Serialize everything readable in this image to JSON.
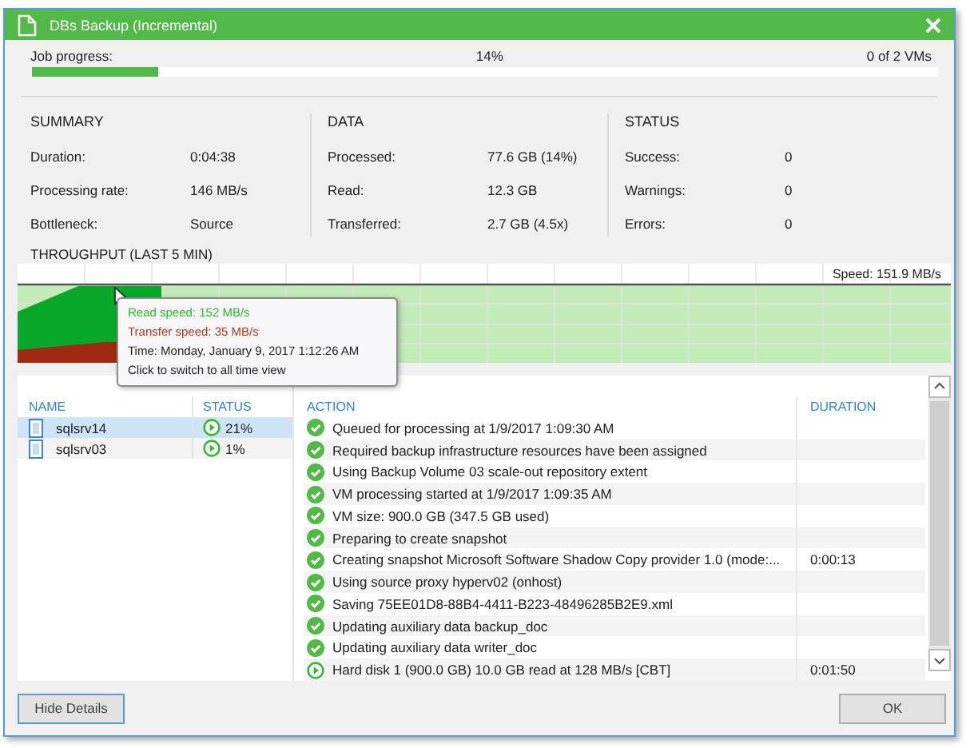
{
  "window": {
    "title": "DBs Backup (Incremental)"
  },
  "job_progress": {
    "label": "Job progress:",
    "percent": "14%",
    "count": "0 of 2 VMs",
    "level": 0.14
  },
  "sections": [
    {
      "title": "SUMMARY",
      "rows": [
        {
          "label": "Duration:",
          "value": "0:04:38"
        },
        {
          "label": "Processing rate:",
          "value": "146 MB/s"
        },
        {
          "label": "Bottleneck:",
          "value": "Source"
        }
      ]
    },
    {
      "title": "DATA",
      "rows": [
        {
          "label": "Processed:",
          "value": "77.6 GB (14%)"
        },
        {
          "label": "Read:",
          "value": "12.3 GB"
        },
        {
          "label": "Transferred:",
          "value": "2.7 GB (4.5x)"
        }
      ]
    },
    {
      "title": "STATUS",
      "rows": [
        {
          "label": "Success:",
          "value": "0"
        },
        {
          "label": "Warnings:",
          "value": "0"
        },
        {
          "label": "Errors:",
          "value": "0"
        }
      ]
    }
  ],
  "throughput": {
    "title": "THROUGHPUT (LAST 5 MIN)",
    "speed": "Speed: 151.9 MB/s",
    "tooltip": [
      {
        "kind": "read",
        "text": "Read speed: 152 MB/s"
      },
      {
        "kind": "transfer",
        "text": "Transfer speed: 35 MB/s"
      },
      {
        "kind": "plain",
        "text": "Time: Monday, January 9, 2017 1:12:26 AM"
      },
      {
        "kind": "plain",
        "text": "Click to switch to all time view"
      }
    ]
  },
  "vm_table": {
    "columns": [
      "NAME",
      "STATUS"
    ],
    "rows": [
      {
        "name": "sqlsrv14",
        "status": "21%",
        "selected": true
      },
      {
        "name": "sqlsrv03",
        "status": "1%",
        "selected": false
      }
    ]
  },
  "action_table": {
    "columns": [
      "ACTION",
      "DURATION"
    ],
    "rows": [
      {
        "kind": "success",
        "action": "Queued for processing at 1/9/2017 1:09:30 AM"
      },
      {
        "kind": "success",
        "action": "Required backup infrastructure resources have been assigned"
      },
      {
        "kind": "success",
        "action": "Using Backup Volume 03 scale-out repository extent"
      },
      {
        "kind": "success",
        "action": "VM processing started at 1/9/2017 1:09:35 AM"
      },
      {
        "kind": "success",
        "action": "VM size: 900.0 GB (347.5 GB used)"
      },
      {
        "kind": "success",
        "action": "Preparing to create snapshot"
      },
      {
        "kind": "success",
        "action": "Creating snapshot Microsoft Software Shadow Copy provider 1.0 (mode:...",
        "duration": "0:00:13"
      },
      {
        "kind": "success",
        "action": "Using source proxy hyperv02 (onhost)"
      },
      {
        "kind": "success",
        "action": "Saving  75EE01D8-88B4-4411-B223-48496285B2E9.xml"
      },
      {
        "kind": "success",
        "action": "Updating auxiliary data backup_doc"
      },
      {
        "kind": "success",
        "action": "Updating auxiliary data writer_doc"
      },
      {
        "kind": "running",
        "action": "Hard disk 1 (900.0 GB) 10.0 GB read at 128 MB/s [CBT]",
        "duration": "0:01:50"
      }
    ]
  },
  "buttons": {
    "left": "Hide Details",
    "right": "OK"
  }
}
